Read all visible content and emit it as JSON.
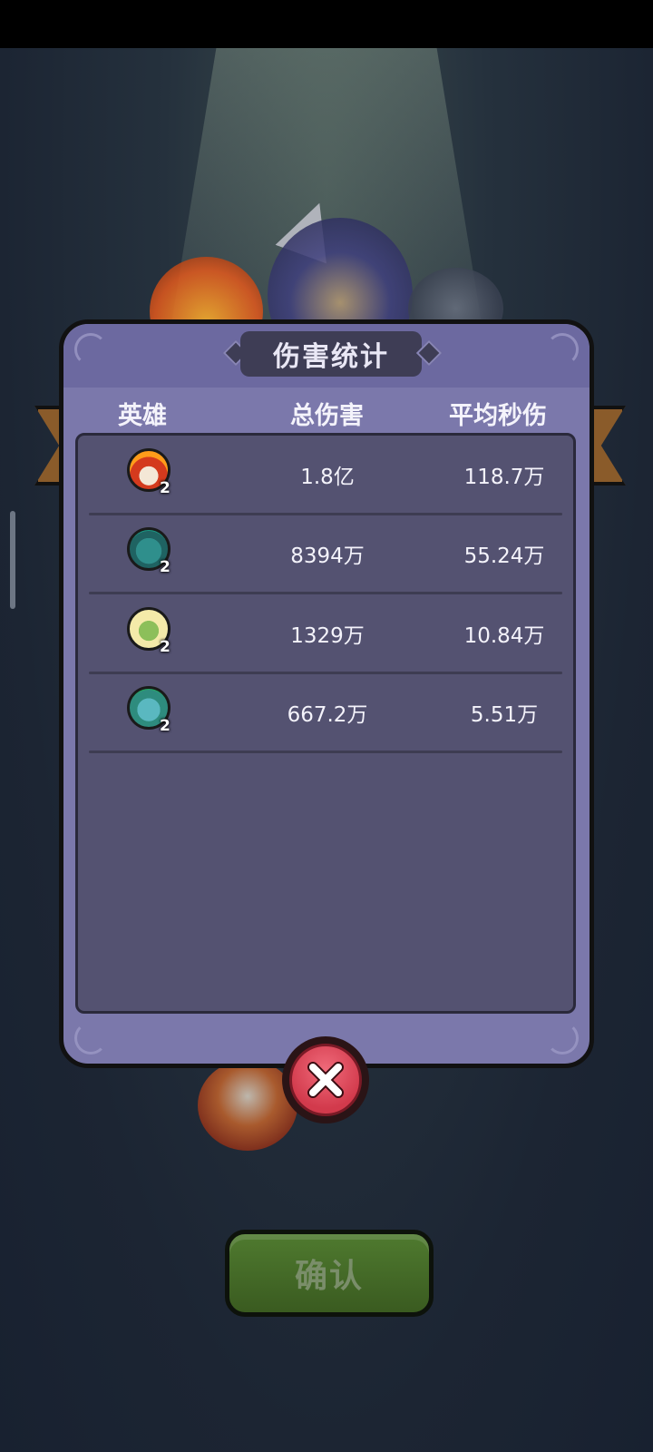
{
  "dialog": {
    "title": "伤害统计",
    "headers": {
      "hero": "英雄",
      "total_damage": "总伤害",
      "avg_dps": "平均秒伤"
    },
    "rows": [
      {
        "hero_icon": "fire-hero-icon",
        "level": "2",
        "total_damage": "1.8亿",
        "avg_dps": "118.7万"
      },
      {
        "hero_icon": "fish-hero-icon",
        "level": "2",
        "total_damage": "8394万",
        "avg_dps": "55.24万"
      },
      {
        "hero_icon": "hooded-goblin-hero-icon",
        "level": "2",
        "total_damage": "1329万",
        "avg_dps": "10.84万"
      },
      {
        "hero_icon": "dragon-hero-icon",
        "level": "2",
        "total_damage": "667.2万",
        "avg_dps": "5.51万"
      }
    ]
  },
  "confirm_label": "确认",
  "colors": {
    "panel": "#7b78ab",
    "table": "#545271",
    "close": "#d23a4c",
    "confirm": "#4f7a2f"
  }
}
